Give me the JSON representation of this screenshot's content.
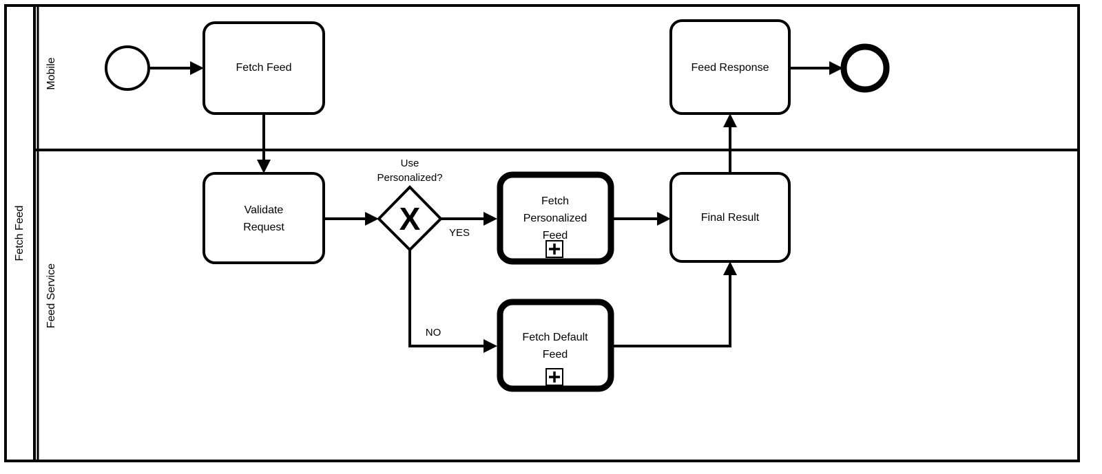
{
  "diagram": {
    "type": "bpmn-collaboration",
    "notation": "BPMN 2.0",
    "pool": {
      "name": "Fetch Feed",
      "lanes": [
        {
          "id": "lane-mobile",
          "name": "Mobile"
        },
        {
          "id": "lane-feed-service",
          "name": "Feed Service"
        }
      ]
    },
    "nodes": [
      {
        "id": "start-event",
        "type": "start-event",
        "label": "",
        "lane": "Mobile"
      },
      {
        "id": "task-fetch-feed",
        "type": "task",
        "label": "Fetch Feed",
        "lane": "Mobile"
      },
      {
        "id": "task-feed-response",
        "type": "task",
        "label": "Feed Response",
        "lane": "Mobile"
      },
      {
        "id": "end-event",
        "type": "end-event",
        "label": "",
        "lane": "Mobile"
      },
      {
        "id": "task-validate-request",
        "type": "task",
        "label": "Validate Request",
        "label_lines": [
          "Validate",
          "Request"
        ],
        "lane": "Feed Service"
      },
      {
        "id": "gateway-use-personalized",
        "type": "exclusive-gateway",
        "label": "Use Personalized?",
        "label_lines": [
          "Use",
          "Personalized?"
        ],
        "marker": "X",
        "lane": "Feed Service"
      },
      {
        "id": "subprocess-fetch-personalized-feed",
        "type": "collapsed-subprocess",
        "label": "Fetch Personalized Feed",
        "label_lines": [
          "Fetch",
          "Personalized",
          "Feed"
        ],
        "marker": "plus",
        "lane": "Feed Service"
      },
      {
        "id": "subprocess-fetch-default-feed",
        "type": "collapsed-subprocess",
        "label": "Fetch Default Feed",
        "label_lines": [
          "Fetch Default",
          "Feed"
        ],
        "marker": "plus",
        "lane": "Feed Service"
      },
      {
        "id": "task-final-result",
        "type": "task",
        "label": "Final Result",
        "lane": "Feed Service"
      }
    ],
    "flows": [
      {
        "id": "flow-start-to-fetch-feed",
        "from": "start-event",
        "to": "task-fetch-feed",
        "label": ""
      },
      {
        "id": "flow-fetch-feed-to-validate",
        "from": "task-fetch-feed",
        "to": "task-validate-request",
        "label": ""
      },
      {
        "id": "flow-validate-to-gateway",
        "from": "task-validate-request",
        "to": "gateway-use-personalized",
        "label": ""
      },
      {
        "id": "flow-gateway-yes",
        "from": "gateway-use-personalized",
        "to": "subprocess-fetch-personalized-feed",
        "label": "YES"
      },
      {
        "id": "flow-gateway-no",
        "from": "gateway-use-personalized",
        "to": "subprocess-fetch-default-feed",
        "label": "NO"
      },
      {
        "id": "flow-personalized-to-final",
        "from": "subprocess-fetch-personalized-feed",
        "to": "task-final-result",
        "label": ""
      },
      {
        "id": "flow-default-to-final",
        "from": "subprocess-fetch-default-feed",
        "to": "task-final-result",
        "label": ""
      },
      {
        "id": "flow-final-to-response",
        "from": "task-final-result",
        "to": "task-feed-response",
        "label": ""
      },
      {
        "id": "flow-response-to-end",
        "from": "task-feed-response",
        "to": "end-event",
        "label": ""
      }
    ],
    "colors": {
      "stroke": "#000000",
      "fill": "#ffffff",
      "background": "#ffffff"
    }
  }
}
